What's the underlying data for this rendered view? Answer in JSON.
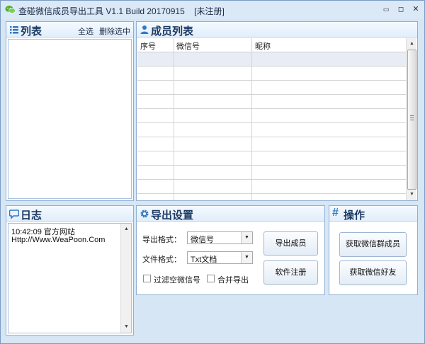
{
  "window": {
    "title": "查碰微信成员导出工具 V1.1 Build 20170915",
    "status_tag": "[未注册]",
    "minimize": "▭",
    "restore": "◻",
    "close": "✕"
  },
  "list_panel": {
    "title": "列表",
    "select_all": "全选",
    "delete_selected": "删除选中"
  },
  "members_panel": {
    "title": "成员列表",
    "columns": [
      "序号",
      "微信号",
      "昵称"
    ],
    "rows": []
  },
  "log_panel": {
    "title": "日志",
    "lines": [
      "10:42:09    官方网站",
      "Http://Www.WeaPoon.Com"
    ]
  },
  "export_panel": {
    "title": "导出设置",
    "format_label": "导出格式：",
    "format_value": "微信号",
    "file_label": "文件格式：",
    "file_value": "Txt文档",
    "filter_label": "过滤空微信号",
    "merge_label": "合并导出",
    "export_button": "导出成员",
    "register_button": "软件注册"
  },
  "ops_panel": {
    "title": "操作",
    "group_button": "获取微信群成员",
    "friends_button": "获取微信好友"
  },
  "colors": {
    "accent": "#2f79c6",
    "panel_title": "#1c3a63",
    "window_bg": "#d6e6f5"
  }
}
